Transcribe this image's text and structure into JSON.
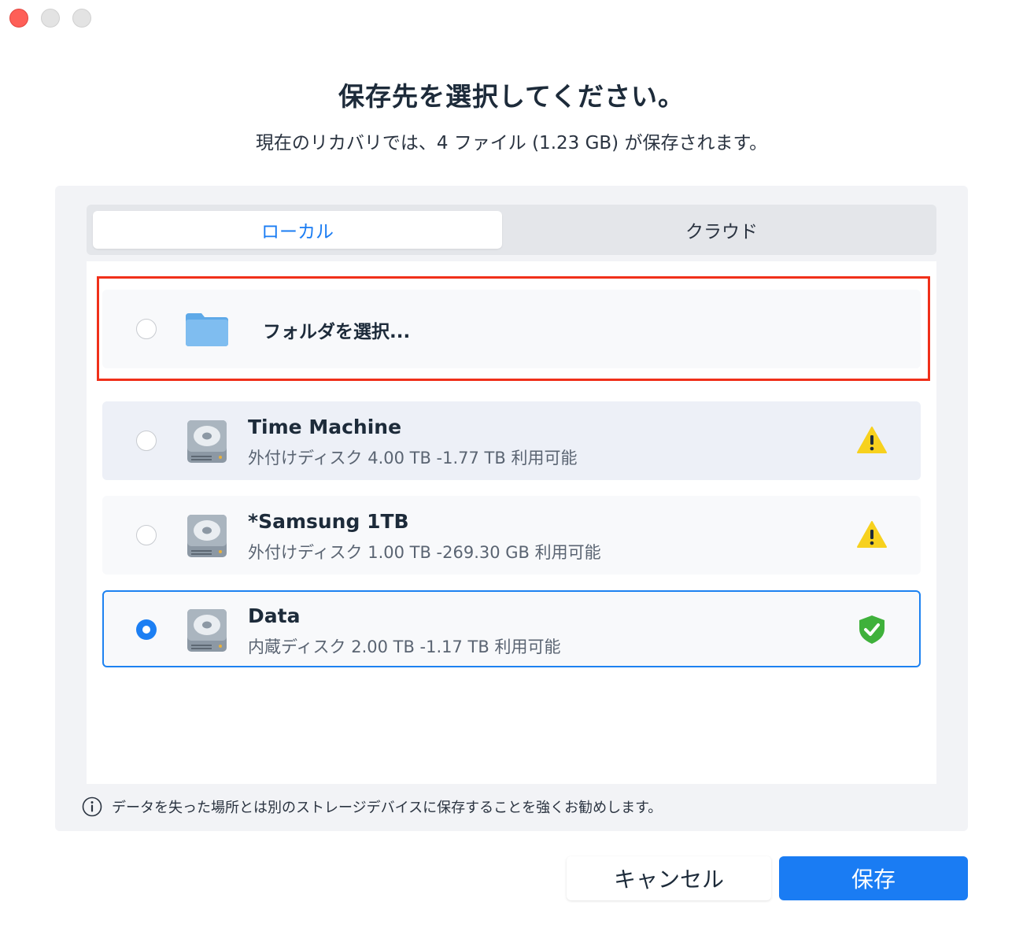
{
  "window": {
    "controls": [
      "close",
      "minimize",
      "maximize"
    ]
  },
  "header": {
    "title": "保存先を選択してください。",
    "subtitle": "現在のリカバリでは、4 ファイル (1.23 GB) が保存されます。"
  },
  "tabs": {
    "local": "ローカル",
    "cloud": "クラウド",
    "selected": "local"
  },
  "destinations": {
    "folder": {
      "label": "フォルダを選択...",
      "icon": "folder-icon",
      "selected": false
    },
    "drives": [
      {
        "name": "Time Machine",
        "info": "外付けディスク 4.00 TB -1.77 TB 利用可能",
        "icon": "hard-drive-icon",
        "status_icon": "warning-icon",
        "selected": false
      },
      {
        "name": "*Samsung 1TB",
        "info": "外付けディスク 1.00 TB -269.30 GB 利用可能",
        "icon": "hard-drive-icon",
        "status_icon": "warning-icon",
        "selected": false
      },
      {
        "name": "Data",
        "info": "内蔵ディスク 2.00 TB -1.17 TB 利用可能",
        "icon": "hard-drive-icon",
        "status_icon": "shield-check-icon",
        "selected": true
      }
    ]
  },
  "note": {
    "icon": "info-icon",
    "text": "データを失った場所とは別のストレージデバイスに保存することを強くお勧めします。"
  },
  "buttons": {
    "cancel": "キャンセル",
    "save": "保存"
  },
  "colors": {
    "accent": "#1a7cf3",
    "highlight_border": "#f0301a",
    "warning": "#f7d11e",
    "safe": "#3fb13b"
  }
}
